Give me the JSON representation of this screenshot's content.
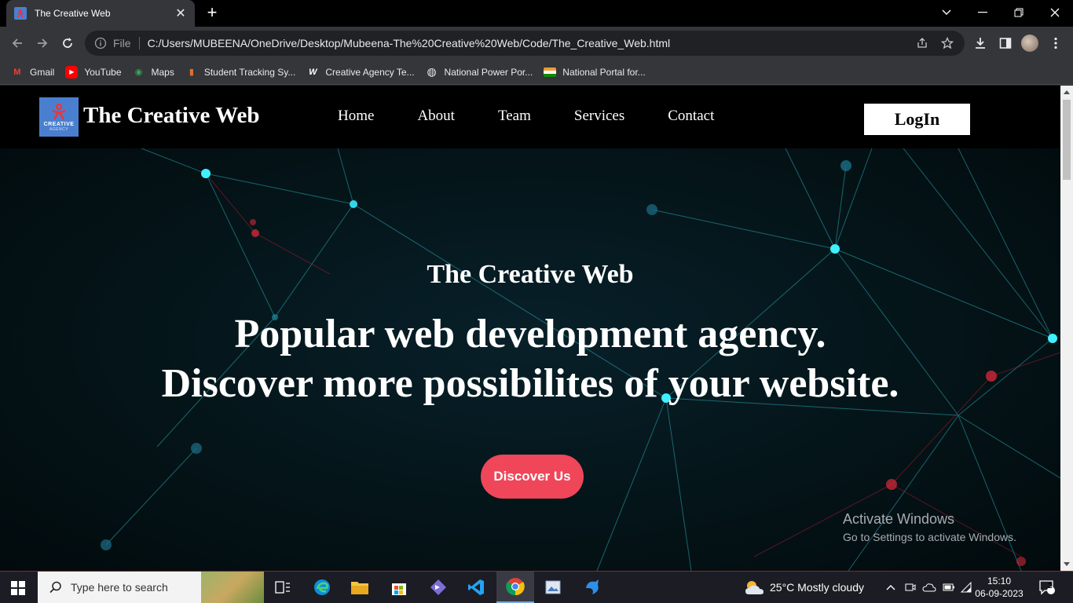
{
  "browser": {
    "tab_title": "The Creative Web",
    "tab_close": "✕",
    "new_tab": "+",
    "omnibox_scheme": "File",
    "url": "C:/Users/MUBEENA/OneDrive/Desktop/Mubeena-The%20Creative%20Web/Code/The_Creative_Web.html"
  },
  "bookmarks": [
    {
      "label": "Gmail",
      "icon": "gmail-icon",
      "color": "#ea4335",
      "glyph": "M"
    },
    {
      "label": "YouTube",
      "icon": "youtube-icon",
      "color": "#ff0000",
      "glyph": "▶"
    },
    {
      "label": "Maps",
      "icon": "maps-icon",
      "color": "#34a853",
      "glyph": "◉"
    },
    {
      "label": "Student Tracking Sy...",
      "icon": "chart-icon",
      "color": "#e07030",
      "glyph": "▮"
    },
    {
      "label": "Creative Agency Te...",
      "icon": "w-icon",
      "color": "#35363a",
      "glyph": "W"
    },
    {
      "label": "National Power Por...",
      "icon": "globe-icon",
      "color": "#9aa0a6",
      "glyph": "◍"
    },
    {
      "label": "National Portal for...",
      "icon": "flag-icon",
      "color": "#ff9933",
      "glyph": "▬"
    }
  ],
  "site": {
    "logo_line1": "CREATIVE",
    "logo_line2": "AGENCY",
    "brand": "The Creative Web",
    "nav": [
      "Home",
      "About",
      "Team",
      "Services",
      "Contact"
    ],
    "login": "LogIn",
    "hero_subtitle": "The Creative Web",
    "hero_line1": "Popular web development agency.",
    "hero_line2": "Discover more possibilites of your website.",
    "cta": "Discover Us",
    "accent_color": "#f0465a"
  },
  "watermark": {
    "title": "Activate Windows",
    "subtitle": "Go to Settings to activate Windows."
  },
  "taskbar": {
    "search_placeholder": "Type here to search",
    "weather": "25°C  Mostly cloudy",
    "time": "15:10",
    "date": "06-09-2023",
    "notifications": "2"
  }
}
